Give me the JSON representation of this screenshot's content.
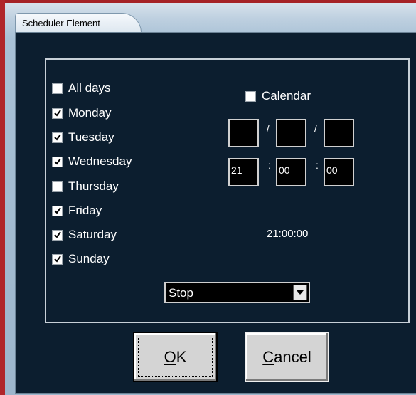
{
  "window": {
    "title": "Scheduler Element"
  },
  "days": {
    "all": {
      "label": "All days",
      "checked": false
    },
    "items": [
      {
        "label": "Monday",
        "checked": true
      },
      {
        "label": "Tuesday",
        "checked": true
      },
      {
        "label": "Wednesday",
        "checked": true
      },
      {
        "label": "Thursday",
        "checked": false
      },
      {
        "label": "Friday",
        "checked": true
      },
      {
        "label": "Saturday",
        "checked": true
      },
      {
        "label": "Sunday",
        "checked": true
      }
    ]
  },
  "calendar": {
    "label": "Calendar",
    "checked": false,
    "date_sep": "/",
    "date": {
      "part1": "",
      "part2": "",
      "part3": ""
    },
    "time_sep": ":",
    "time": {
      "hours": "21",
      "minutes": "00",
      "seconds": "00"
    }
  },
  "time_display": "21:00:00",
  "action": {
    "selected": "Stop"
  },
  "buttons": {
    "ok": {
      "mnemonic": "O",
      "rest": "K"
    },
    "cancel": {
      "mnemonic": "C",
      "rest": "ancel"
    }
  },
  "colors": {
    "dialog_bg": "#0c1e2f",
    "text": "#ffffff",
    "frame_accent": "#b0262a"
  }
}
